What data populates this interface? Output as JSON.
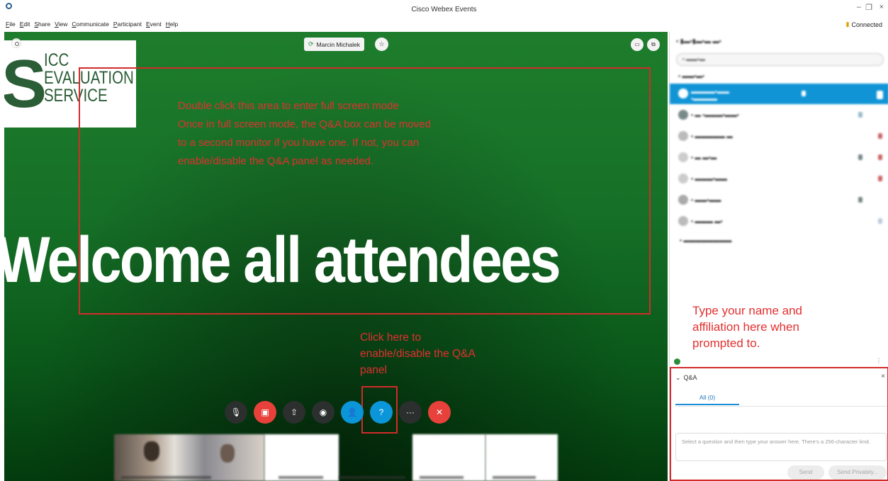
{
  "window": {
    "title": "Cisco Webex Events",
    "minimize_glyph": "–",
    "restore_glyph": "❐",
    "close_glyph": "×",
    "connection_status": "Connected"
  },
  "menu": [
    "File",
    "Edit",
    "Share",
    "View",
    "Communicate",
    "Participant",
    "Event",
    "Help"
  ],
  "stage": {
    "presenter_name": "Marcin Michalek",
    "slide": {
      "logo_letter": "S",
      "logo_lines": [
        "ICC",
        "EVALUATION",
        "SERVICE"
      ],
      "headline": "Welcome all attendees"
    }
  },
  "controls": {
    "buttons": [
      {
        "name": "mute-button",
        "icon": "microphone-muted-icon",
        "glyph": "🎙",
        "color": "dark"
      },
      {
        "name": "video-button",
        "icon": "video-off-icon",
        "glyph": "▣",
        "color": "red"
      },
      {
        "name": "share-button",
        "icon": "share-icon",
        "glyph": "⇧",
        "color": "dark"
      },
      {
        "name": "record-button",
        "icon": "record-icon",
        "glyph": "◉",
        "color": "dark"
      },
      {
        "name": "participants-button",
        "icon": "person-icon",
        "glyph": "👤",
        "color": "blue"
      },
      {
        "name": "qa-button",
        "icon": "question-icon",
        "glyph": "?",
        "color": "blue"
      },
      {
        "name": "more-button",
        "icon": "more-icon",
        "glyph": "···",
        "color": "dark"
      },
      {
        "name": "leave-button",
        "icon": "close-icon",
        "glyph": "✕",
        "color": "red"
      }
    ]
  },
  "annotations": {
    "fullscreen_text": "Double click this area to enter full screen mode\nOnce in full screen mode, the Q&A box can be moved\nto a second monitor if you have one. If not, you can\nenable/disable the Q&A panel as needed.",
    "qa_toggle_text": "Click here to\nenable/disable the Q&A\npanel",
    "name_text": "Type your name and\naffiliation here when\nprompted to.",
    "color": "#e23030"
  },
  "qa": {
    "title": "Q&A",
    "tab_all": "All (0)",
    "input_placeholder": "Select a question and then type your answer here. There's a 256-character limit.",
    "send_label": "Send",
    "send_privately_label": "Send Privately..."
  },
  "colors": {
    "accent_blue": "#1094d6",
    "annotation_red": "#d22b2b",
    "stage_green": "#167027"
  }
}
